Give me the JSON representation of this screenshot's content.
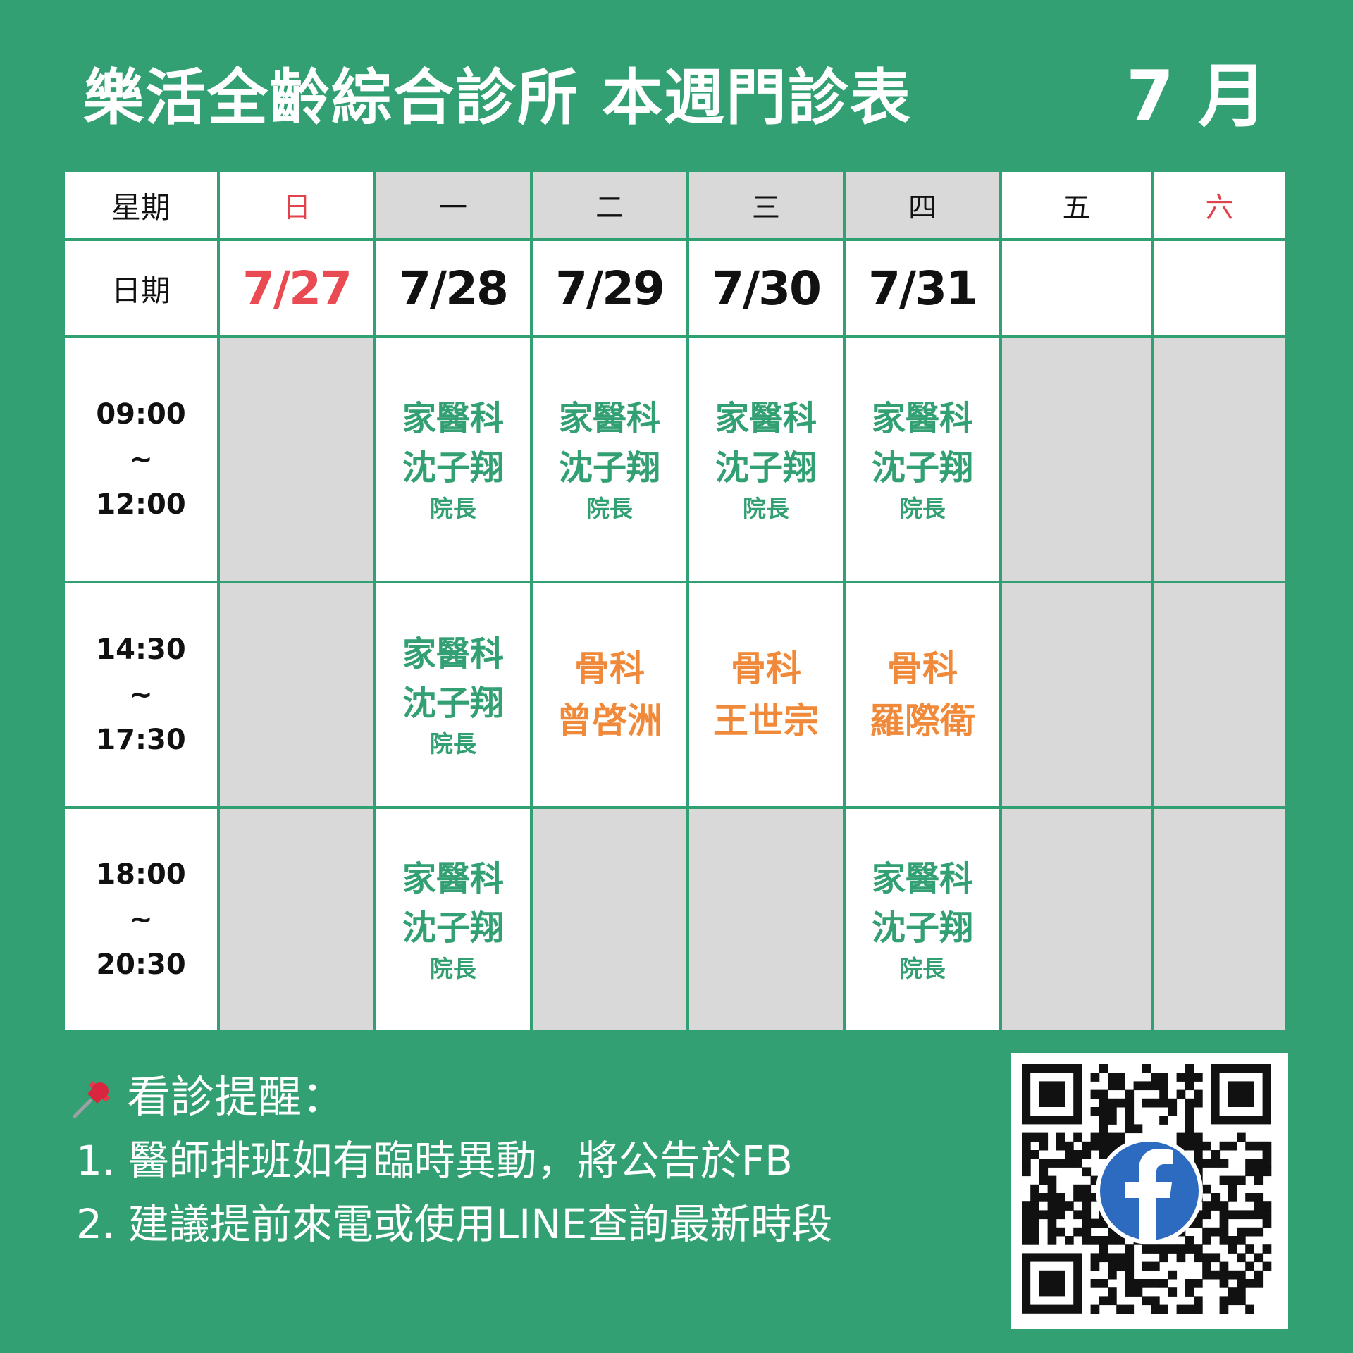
{
  "header": {
    "title": "樂活全齡綜合診所 本週門診表",
    "month": "7 月"
  },
  "table": {
    "weekday_label": "星期",
    "date_label": "日期",
    "weekdays": [
      "日",
      "一",
      "二",
      "三",
      "四",
      "五",
      "六"
    ],
    "dates": [
      "7/27",
      "7/28",
      "7/29",
      "7/30",
      "7/31",
      "",
      ""
    ],
    "sessions": [
      {
        "start": "09:00",
        "sep": "~",
        "end": "12:00",
        "slots": [
          null,
          {
            "dept": "家醫科",
            "doctor": "沈子翔",
            "title": "院長"
          },
          {
            "dept": "家醫科",
            "doctor": "沈子翔",
            "title": "院長"
          },
          {
            "dept": "家醫科",
            "doctor": "沈子翔",
            "title": "院長"
          },
          {
            "dept": "家醫科",
            "doctor": "沈子翔",
            "title": "院長"
          },
          null,
          null
        ]
      },
      {
        "start": "14:30",
        "sep": "~",
        "end": "17:30",
        "slots": [
          null,
          {
            "dept": "家醫科",
            "doctor": "沈子翔",
            "title": "院長"
          },
          {
            "dept": "骨科",
            "doctor": "曾啓洲"
          },
          {
            "dept": "骨科",
            "doctor": "王世宗"
          },
          {
            "dept": "骨科",
            "doctor": "羅際衛"
          },
          null,
          null
        ]
      },
      {
        "start": "18:00",
        "sep": "~",
        "end": "20:30",
        "slots": [
          null,
          {
            "dept": "家醫科",
            "doctor": "沈子翔",
            "title": "院長"
          },
          null,
          null,
          {
            "dept": "家醫科",
            "doctor": "沈子翔",
            "title": "院長"
          },
          null,
          null
        ]
      }
    ]
  },
  "notes": {
    "heading": "看診提醒：",
    "icon": "pushpin-icon",
    "items": [
      "1. 醫師排班如有臨時異動，將公告於FB",
      "2. 建議提前來電或使用LINE查詢最新時段"
    ]
  },
  "qr": {
    "icon": "facebook-icon"
  },
  "colors": {
    "background": "#32a072",
    "green_text": "#32a072",
    "orange_text": "#f08a3a",
    "red_text": "#e0434c",
    "closed_cell": "#d9d9d9",
    "facebook": "#2c6bc0"
  }
}
